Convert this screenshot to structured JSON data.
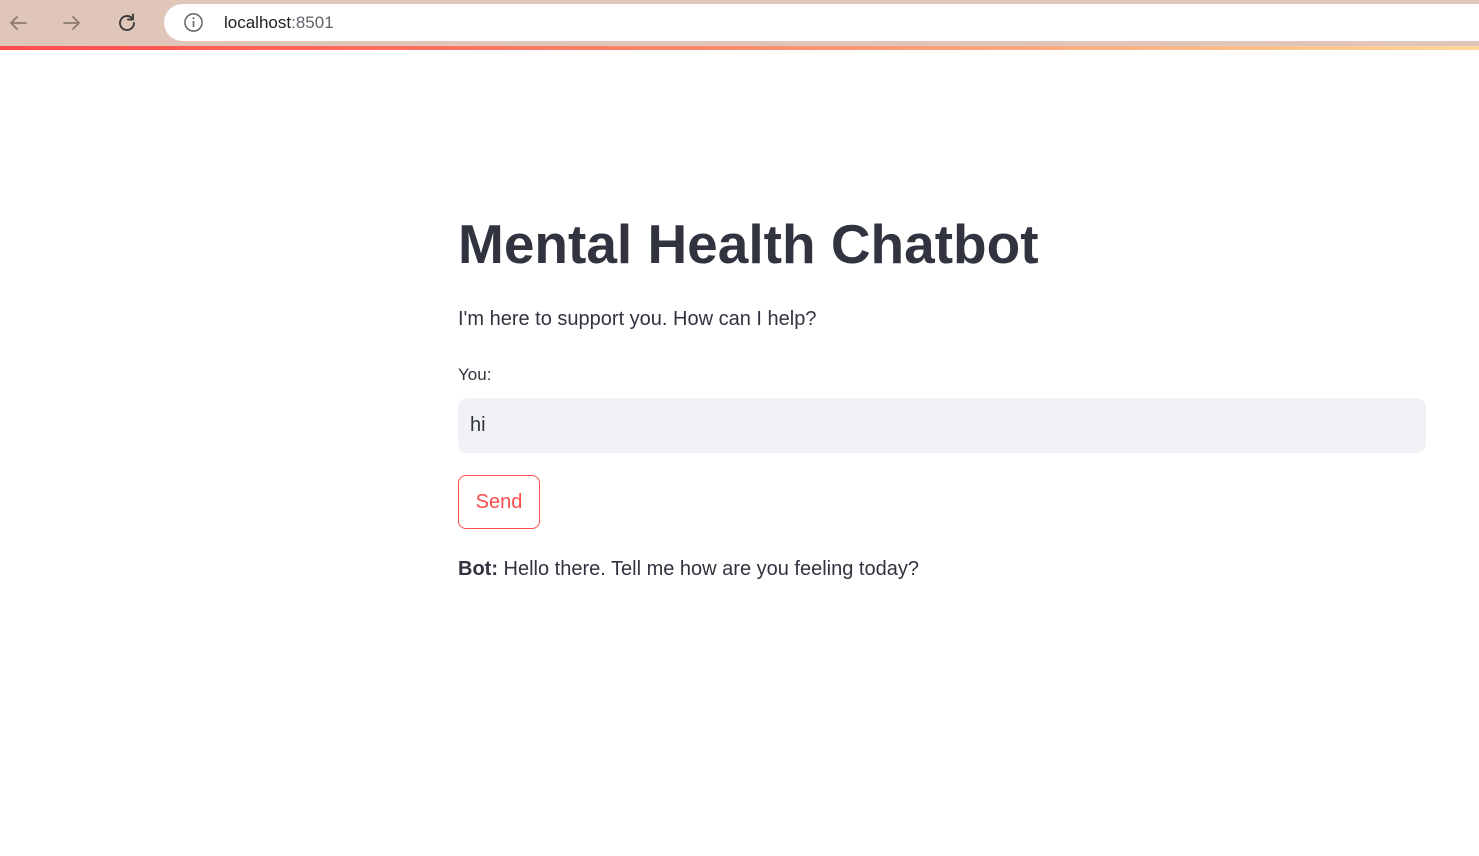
{
  "browser": {
    "url_host": "localhost",
    "url_port": ":8501",
    "back_icon": "arrow-left-icon",
    "forward_icon": "arrow-right-icon",
    "reload_icon": "reload-icon",
    "info_icon": "info-icon"
  },
  "page": {
    "title": "Mental Health Chatbot",
    "subtitle": "I'm here to support you. How can I help?",
    "input_label": "You:",
    "input_value": "hi",
    "send_label": "Send",
    "bot_name": "Bot:",
    "bot_message": " Hello there. Tell me how are you feeling today?"
  },
  "colors": {
    "accent": "#ff4b4b",
    "text": "#31333f",
    "input_bg": "#f0f2f6",
    "browser_bar": "#dfc6b8"
  }
}
